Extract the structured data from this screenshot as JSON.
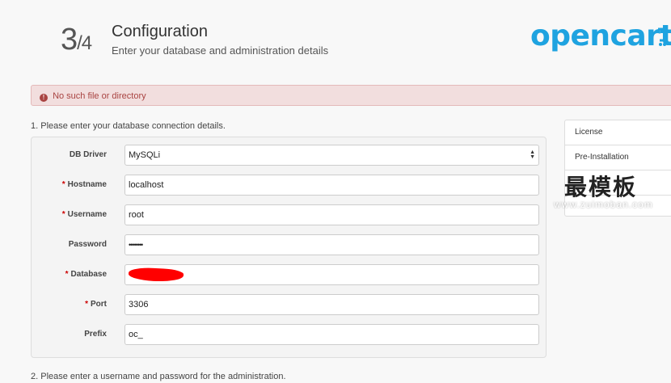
{
  "header": {
    "step": "3",
    "step_total": "/4",
    "title": "Configuration",
    "subtitle": "Enter your database and administration details",
    "logo": "opencart"
  },
  "alert": {
    "icon": "exclamation-circle-icon",
    "message": "No such file or directory"
  },
  "sections": {
    "db_label": "1. Please enter your database connection details.",
    "admin_label": "2. Please enter a username and password for the administration."
  },
  "form": {
    "db_driver": {
      "label": "DB Driver",
      "value": "MySQLi"
    },
    "hostname": {
      "label": "Hostname",
      "value": "localhost"
    },
    "username": {
      "label": "Username",
      "value": "root"
    },
    "password": {
      "label": "Password",
      "value": "••••••••"
    },
    "database": {
      "label": "Database",
      "value": ""
    },
    "port": {
      "label": "Port",
      "value": "3306"
    },
    "prefix": {
      "label": "Prefix",
      "value": "oc_"
    },
    "required_mark": "*"
  },
  "menu": {
    "items": [
      "License",
      "Pre-Installation"
    ]
  },
  "watermark": {
    "text": "最模板",
    "sub": "www.zuimoban.com"
  },
  "colors": {
    "logo": "#1fa3e0",
    "alert_bg": "#f2dede",
    "alert_text": "#a94442",
    "required": "#cc0000"
  }
}
